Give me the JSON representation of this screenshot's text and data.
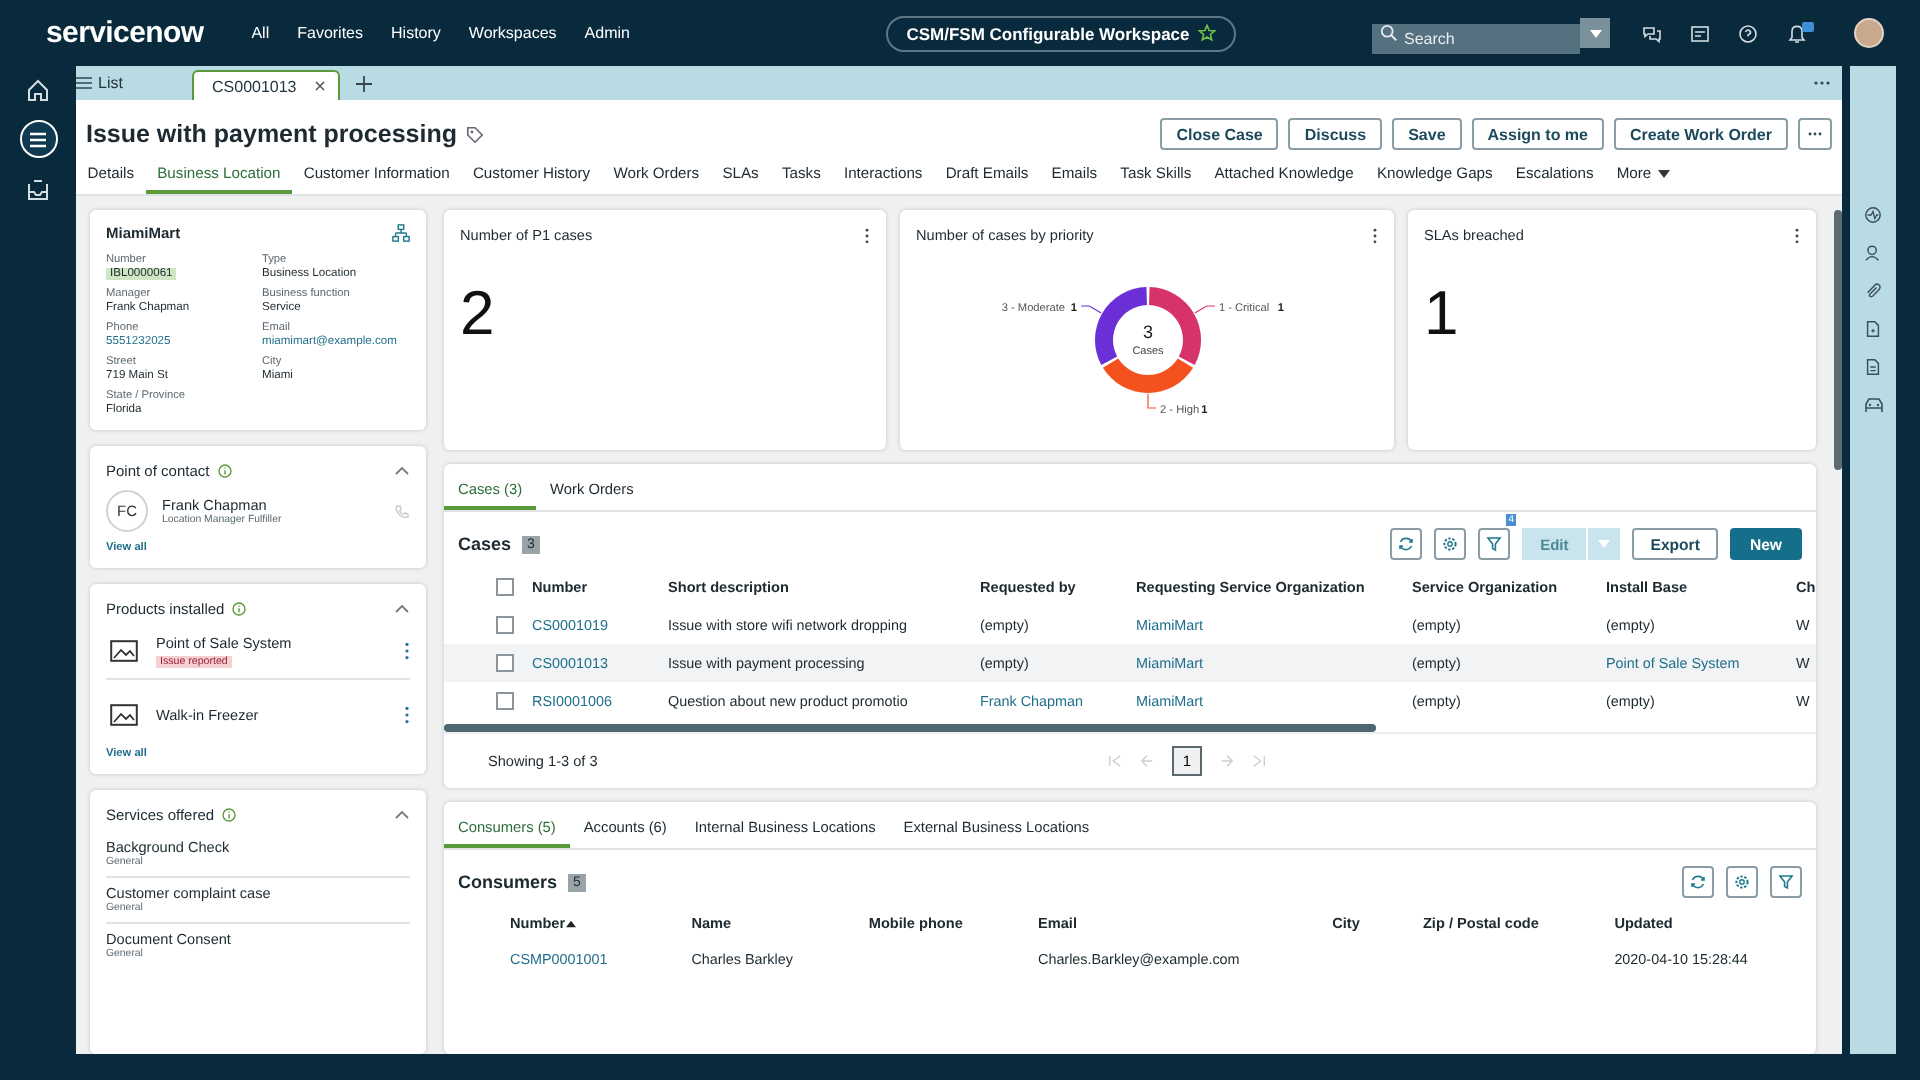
{
  "top_bar": {
    "logo": "servicenow",
    "nav": [
      "All",
      "Favorites",
      "History",
      "Workspaces",
      "Admin"
    ],
    "workspace": "CSM/FSM Configurable Workspace",
    "search": {
      "placeholder": "Search"
    }
  },
  "left_rail": [
    {
      "kind": "home",
      "selected": false
    },
    {
      "kind": "list",
      "selected": true
    },
    {
      "kind": "inbox",
      "selected": false
    }
  ],
  "tab_bar": {
    "list_label": "List",
    "tabs": [
      {
        "label": "CS0001013",
        "selected": true
      }
    ]
  },
  "record": {
    "title": "Issue with payment processing",
    "actions": [
      "Close Case",
      "Discuss",
      "Save",
      "Assign to me",
      "Create Work Order"
    ],
    "tabs": [
      {
        "label": "Details",
        "selected": false
      },
      {
        "label": "Business Location",
        "selected": true
      },
      {
        "label": "Customer Information",
        "selected": false
      },
      {
        "label": "Customer History",
        "selected": false
      },
      {
        "label": "Work Orders",
        "selected": false
      },
      {
        "label": "SLAs",
        "selected": false
      },
      {
        "label": "Tasks",
        "selected": false
      },
      {
        "label": "Interactions",
        "selected": false
      },
      {
        "label": "Draft Emails",
        "selected": false
      },
      {
        "label": "Emails",
        "selected": false
      },
      {
        "label": "Task Skills",
        "selected": false
      },
      {
        "label": "Attached Knowledge",
        "selected": false
      },
      {
        "label": "Knowledge Gaps",
        "selected": false
      },
      {
        "label": "Escalations",
        "selected": false
      }
    ],
    "more": "More"
  },
  "location_card": {
    "name": "MiamiMart",
    "fields": [
      {
        "label": "Number",
        "value": "IBL0000061",
        "kind": "tag"
      },
      {
        "label": "Type",
        "value": "Business Location",
        "kind": "text"
      },
      {
        "label": "Manager",
        "value": "Frank Chapman",
        "kind": "text"
      },
      {
        "label": "Business function",
        "value": "Service",
        "kind": "text"
      },
      {
        "label": "Phone",
        "value": "5551232025",
        "kind": "link"
      },
      {
        "label": "Email",
        "value": "miamimart@example.com",
        "kind": "link"
      },
      {
        "label": "Street",
        "value": "719 Main St",
        "kind": "text"
      },
      {
        "label": "City",
        "value": "Miami",
        "kind": "text"
      },
      {
        "label": "State / Province",
        "value": "Florida",
        "kind": "text"
      }
    ]
  },
  "contact_card": {
    "title": "Point of contact",
    "expanded": true,
    "initials": "FC",
    "name": "Frank Chapman",
    "role": "Location Manager Fulfiller",
    "view_all": "View all"
  },
  "products_card": {
    "title": "Products installed",
    "expanded": true,
    "items": [
      {
        "name": "Point of Sale System",
        "status": "Issue reported"
      },
      {
        "name": "Walk-in Freezer"
      }
    ],
    "view_all": "View all"
  },
  "services_card": {
    "title": "Services offered",
    "expanded": true,
    "items": [
      {
        "name": "Background Check",
        "category": "General"
      },
      {
        "name": "Customer complaint case",
        "category": "General"
      },
      {
        "name": "Document Consent",
        "category": "General"
      }
    ]
  },
  "widgets": [
    {
      "kind": "number",
      "title": "Number of P1 cases",
      "value": "2"
    },
    {
      "kind": "chart",
      "title": "Number of cases by priority",
      "center_value": "3",
      "chart_data": {
        "type": "donut",
        "categories": [
          "1 - Critical",
          "2 - High",
          "3 - Moderate"
        ],
        "series": [
          {
            "name": "Cases",
            "values": [
              1,
              1,
              1
            ]
          }
        ],
        "colors": [
          "#d6336c",
          "#f4511e",
          "#6a2fd6"
        ],
        "value_labels": [
          "1",
          "1",
          "1"
        ]
      }
    },
    {
      "kind": "number",
      "title": "SLAs breached",
      "value": "1"
    }
  ],
  "cases_panel": {
    "tabs": [
      {
        "label": "Cases (3)",
        "selected": true
      },
      {
        "label": "Work Orders",
        "selected": false
      }
    ],
    "title": "Cases",
    "count": "3",
    "filter_count": "4",
    "edit": {
      "label": "Edit",
      "disabled": true
    },
    "export": "Export",
    "new": "New",
    "all_checked": false,
    "columns": [
      "Number",
      "Short description",
      "Requested by",
      "Requesting Service Organization",
      "Service Organization",
      "Install Base",
      "Ch"
    ],
    "rows": [
      {
        "checked": false,
        "current": false,
        "cells": [
          {
            "text": "CS0001019",
            "link": true
          },
          {
            "text": "Issue with store wifi network dropping",
            "link": false
          },
          {
            "text": "(empty)",
            "link": false
          },
          {
            "text": "MiamiMart",
            "link": true
          },
          {
            "text": "(empty)",
            "link": false
          },
          {
            "text": "(empty)",
            "link": false
          },
          {
            "text": "W",
            "link": false
          }
        ]
      },
      {
        "checked": false,
        "current": true,
        "cells": [
          {
            "text": "CS0001013",
            "link": true
          },
          {
            "text": "Issue with payment processing",
            "link": false
          },
          {
            "text": "(empty)",
            "link": false
          },
          {
            "text": "MiamiMart",
            "link": true
          },
          {
            "text": "(empty)",
            "link": false
          },
          {
            "text": "Point of Sale System",
            "link": true
          },
          {
            "text": "W",
            "link": false
          }
        ]
      },
      {
        "checked": false,
        "current": false,
        "cells": [
          {
            "text": "RSI0001006",
            "link": true
          },
          {
            "text": "Question about new product promotio",
            "link": false
          },
          {
            "text": "Frank Chapman",
            "link": true
          },
          {
            "text": "MiamiMart",
            "link": true
          },
          {
            "text": "(empty)",
            "link": false
          },
          {
            "text": "(empty)",
            "link": false
          },
          {
            "text": "W",
            "link": false
          }
        ]
      }
    ],
    "footer": "Showing 1-3 of 3",
    "pages": [
      {
        "label": "1",
        "selected": true
      }
    ]
  },
  "consumers_panel": {
    "tabs": [
      {
        "label": "Consumers (5)",
        "selected": true
      },
      {
        "label": "Accounts (6)",
        "selected": false
      },
      {
        "label": "Internal Business Locations",
        "selected": false
      },
      {
        "label": "External Business Locations",
        "selected": false
      }
    ],
    "title": "Consumers",
    "count": "5",
    "columns": [
      {
        "label": "Number",
        "sorted": true
      },
      {
        "label": "Name",
        "sorted": false
      },
      {
        "label": "Mobile phone",
        "sorted": false
      },
      {
        "label": "Email",
        "sorted": false
      },
      {
        "label": "City",
        "sorted": false
      },
      {
        "label": "Zip / Postal code",
        "sorted": false
      },
      {
        "label": "Updated",
        "sorted": false
      }
    ],
    "rows": [
      {
        "cells": [
          {
            "text": "CSMP0001001",
            "link": true
          },
          {
            "text": "Charles Barkley",
            "link": false
          },
          null,
          {
            "text": "Charles.Barkley@example.com",
            "link": false
          },
          null,
          null,
          {
            "text": "2020-04-10 15:28:44",
            "link": false
          }
        ]
      }
    ]
  }
}
